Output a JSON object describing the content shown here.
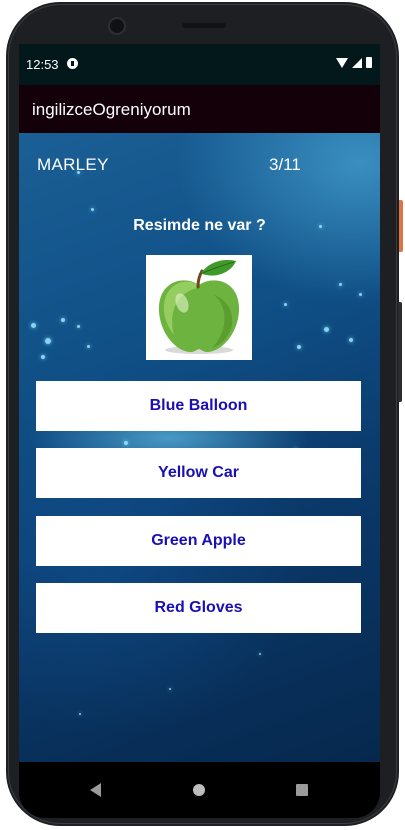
{
  "status_bar": {
    "time": "12:53"
  },
  "app_bar": {
    "title": "ingilizceOgreniyorum"
  },
  "quiz": {
    "player_name": "MARLEY",
    "progress": "3/11",
    "question": "Resimde ne var ?",
    "image_subject": "green-apple",
    "answers": [
      {
        "label": "Blue Balloon"
      },
      {
        "label": "Yellow Car"
      },
      {
        "label": "Green Apple"
      },
      {
        "label": "Red Gloves"
      }
    ]
  },
  "colors": {
    "status_bar_bg": "#03181b",
    "app_bar_bg": "#140008",
    "answer_text": "#1a0fb4",
    "answer_bg": "#ffffff",
    "background_accent": "#0f4f86"
  },
  "icons": {
    "status": [
      "notification-icon",
      "wifi-icon",
      "signal-icon",
      "battery-icon"
    ],
    "nav": [
      "back-icon",
      "home-icon",
      "recents-icon"
    ]
  }
}
